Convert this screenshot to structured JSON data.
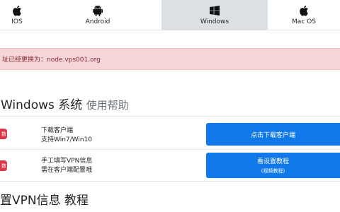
{
  "tabs": [
    {
      "label": "IOS",
      "icon": "apple-icon",
      "active": false
    },
    {
      "label": "Android",
      "icon": "android-icon",
      "active": false
    },
    {
      "label": "Windows",
      "icon": "windows-icon",
      "active": true
    },
    {
      "label": "Mac OS",
      "icon": "apple-icon",
      "active": false
    }
  ],
  "notice": {
    "text": "址已经更换为：node.vps001.org"
  },
  "section": {
    "title": "Windows 系统",
    "subtitle": "使用帮助"
  },
  "rows": [
    {
      "badge": "数",
      "line1": "下载客户端",
      "line2": "支持Win7/Win10",
      "button": "点击下载客户端",
      "button_sub": ""
    },
    {
      "badge": "数",
      "line1": "手工填写VPN信息",
      "line2": "需在客户端配置哦",
      "button": "看设置教程",
      "button_sub": "(视频教程)"
    }
  ],
  "section2": {
    "title": "置VPN信息 教程"
  },
  "colors": {
    "accent": "#1178ea",
    "danger": "#dc3545",
    "notice_bg": "#f5d5d8",
    "active_tab": "#dde0e3"
  }
}
